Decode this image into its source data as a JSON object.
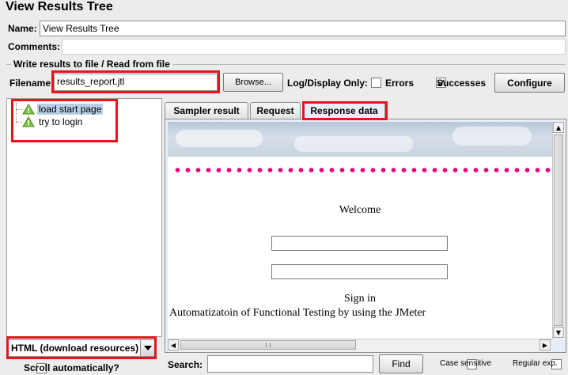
{
  "header": {
    "title": "View Results Tree"
  },
  "name_field": {
    "label": "Name:",
    "value": "View Results Tree"
  },
  "comments_field": {
    "label": "Comments:",
    "value": ""
  },
  "file_group": {
    "title": "Write results to file / Read from file",
    "filename_label": "Filename",
    "filename_value": "results_report.jtl",
    "browse_label": "Browse...",
    "log_display_label": "Log/Display Only:",
    "errors_label": "Errors",
    "errors_checked": false,
    "successes_label": "Successes",
    "successes_checked": true,
    "configure_label": "Configure"
  },
  "tree": {
    "items": [
      {
        "label": "load start page",
        "selected": true
      },
      {
        "label": "try to login",
        "selected": false
      }
    ]
  },
  "renderer_select": {
    "value": "HTML (download resources)"
  },
  "scroll_auto": {
    "label": "Scroll automatically?",
    "checked": false
  },
  "tabs": [
    {
      "label": "Sampler result",
      "active": false
    },
    {
      "label": "Request",
      "active": false
    },
    {
      "label": "Response data",
      "active": true
    }
  ],
  "response": {
    "welcome": "Welcome",
    "sign_in": "Sign in",
    "footer_text": "Automatizatoin of Functional Testing by using the JMeter"
  },
  "search": {
    "label": "Search:",
    "value": "",
    "find_label": "Find",
    "case_sensitive_label": "Case sensitive",
    "regular_exp_label": "Regular exp."
  },
  "colors": {
    "highlight_red": "#e5141d",
    "dots_pink": "#e6007e",
    "selection_blue": "#b8cfe5"
  }
}
